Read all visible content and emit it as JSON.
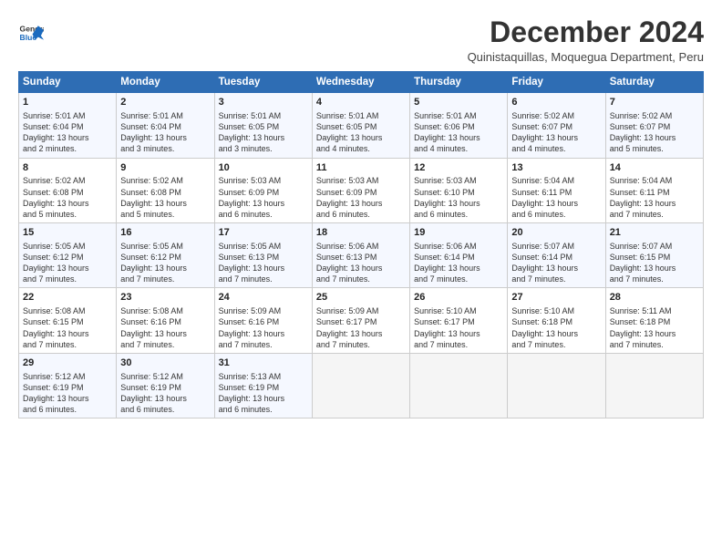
{
  "header": {
    "logo_general": "General",
    "logo_blue": "Blue",
    "title": "December 2024",
    "subtitle": "Quinistaquillas, Moquegua Department, Peru"
  },
  "calendar": {
    "columns": [
      "Sunday",
      "Monday",
      "Tuesday",
      "Wednesday",
      "Thursday",
      "Friday",
      "Saturday"
    ],
    "rows": [
      [
        {
          "day": "1",
          "lines": [
            "Sunrise: 5:01 AM",
            "Sunset: 6:04 PM",
            "Daylight: 13 hours",
            "and 2 minutes."
          ]
        },
        {
          "day": "2",
          "lines": [
            "Sunrise: 5:01 AM",
            "Sunset: 6:04 PM",
            "Daylight: 13 hours",
            "and 3 minutes."
          ]
        },
        {
          "day": "3",
          "lines": [
            "Sunrise: 5:01 AM",
            "Sunset: 6:05 PM",
            "Daylight: 13 hours",
            "and 3 minutes."
          ]
        },
        {
          "day": "4",
          "lines": [
            "Sunrise: 5:01 AM",
            "Sunset: 6:05 PM",
            "Daylight: 13 hours",
            "and 4 minutes."
          ]
        },
        {
          "day": "5",
          "lines": [
            "Sunrise: 5:01 AM",
            "Sunset: 6:06 PM",
            "Daylight: 13 hours",
            "and 4 minutes."
          ]
        },
        {
          "day": "6",
          "lines": [
            "Sunrise: 5:02 AM",
            "Sunset: 6:07 PM",
            "Daylight: 13 hours",
            "and 4 minutes."
          ]
        },
        {
          "day": "7",
          "lines": [
            "Sunrise: 5:02 AM",
            "Sunset: 6:07 PM",
            "Daylight: 13 hours",
            "and 5 minutes."
          ]
        }
      ],
      [
        {
          "day": "8",
          "lines": [
            "Sunrise: 5:02 AM",
            "Sunset: 6:08 PM",
            "Daylight: 13 hours",
            "and 5 minutes."
          ]
        },
        {
          "day": "9",
          "lines": [
            "Sunrise: 5:02 AM",
            "Sunset: 6:08 PM",
            "Daylight: 13 hours",
            "and 5 minutes."
          ]
        },
        {
          "day": "10",
          "lines": [
            "Sunrise: 5:03 AM",
            "Sunset: 6:09 PM",
            "Daylight: 13 hours",
            "and 6 minutes."
          ]
        },
        {
          "day": "11",
          "lines": [
            "Sunrise: 5:03 AM",
            "Sunset: 6:09 PM",
            "Daylight: 13 hours",
            "and 6 minutes."
          ]
        },
        {
          "day": "12",
          "lines": [
            "Sunrise: 5:03 AM",
            "Sunset: 6:10 PM",
            "Daylight: 13 hours",
            "and 6 minutes."
          ]
        },
        {
          "day": "13",
          "lines": [
            "Sunrise: 5:04 AM",
            "Sunset: 6:11 PM",
            "Daylight: 13 hours",
            "and 6 minutes."
          ]
        },
        {
          "day": "14",
          "lines": [
            "Sunrise: 5:04 AM",
            "Sunset: 6:11 PM",
            "Daylight: 13 hours",
            "and 7 minutes."
          ]
        }
      ],
      [
        {
          "day": "15",
          "lines": [
            "Sunrise: 5:05 AM",
            "Sunset: 6:12 PM",
            "Daylight: 13 hours",
            "and 7 minutes."
          ]
        },
        {
          "day": "16",
          "lines": [
            "Sunrise: 5:05 AM",
            "Sunset: 6:12 PM",
            "Daylight: 13 hours",
            "and 7 minutes."
          ]
        },
        {
          "day": "17",
          "lines": [
            "Sunrise: 5:05 AM",
            "Sunset: 6:13 PM",
            "Daylight: 13 hours",
            "and 7 minutes."
          ]
        },
        {
          "day": "18",
          "lines": [
            "Sunrise: 5:06 AM",
            "Sunset: 6:13 PM",
            "Daylight: 13 hours",
            "and 7 minutes."
          ]
        },
        {
          "day": "19",
          "lines": [
            "Sunrise: 5:06 AM",
            "Sunset: 6:14 PM",
            "Daylight: 13 hours",
            "and 7 minutes."
          ]
        },
        {
          "day": "20",
          "lines": [
            "Sunrise: 5:07 AM",
            "Sunset: 6:14 PM",
            "Daylight: 13 hours",
            "and 7 minutes."
          ]
        },
        {
          "day": "21",
          "lines": [
            "Sunrise: 5:07 AM",
            "Sunset: 6:15 PM",
            "Daylight: 13 hours",
            "and 7 minutes."
          ]
        }
      ],
      [
        {
          "day": "22",
          "lines": [
            "Sunrise: 5:08 AM",
            "Sunset: 6:15 PM",
            "Daylight: 13 hours",
            "and 7 minutes."
          ]
        },
        {
          "day": "23",
          "lines": [
            "Sunrise: 5:08 AM",
            "Sunset: 6:16 PM",
            "Daylight: 13 hours",
            "and 7 minutes."
          ]
        },
        {
          "day": "24",
          "lines": [
            "Sunrise: 5:09 AM",
            "Sunset: 6:16 PM",
            "Daylight: 13 hours",
            "and 7 minutes."
          ]
        },
        {
          "day": "25",
          "lines": [
            "Sunrise: 5:09 AM",
            "Sunset: 6:17 PM",
            "Daylight: 13 hours",
            "and 7 minutes."
          ]
        },
        {
          "day": "26",
          "lines": [
            "Sunrise: 5:10 AM",
            "Sunset: 6:17 PM",
            "Daylight: 13 hours",
            "and 7 minutes."
          ]
        },
        {
          "day": "27",
          "lines": [
            "Sunrise: 5:10 AM",
            "Sunset: 6:18 PM",
            "Daylight: 13 hours",
            "and 7 minutes."
          ]
        },
        {
          "day": "28",
          "lines": [
            "Sunrise: 5:11 AM",
            "Sunset: 6:18 PM",
            "Daylight: 13 hours",
            "and 7 minutes."
          ]
        }
      ],
      [
        {
          "day": "29",
          "lines": [
            "Sunrise: 5:12 AM",
            "Sunset: 6:19 PM",
            "Daylight: 13 hours",
            "and 6 minutes."
          ]
        },
        {
          "day": "30",
          "lines": [
            "Sunrise: 5:12 AM",
            "Sunset: 6:19 PM",
            "Daylight: 13 hours",
            "and 6 minutes."
          ]
        },
        {
          "day": "31",
          "lines": [
            "Sunrise: 5:13 AM",
            "Sunset: 6:19 PM",
            "Daylight: 13 hours",
            "and 6 minutes."
          ]
        },
        {
          "day": "",
          "lines": []
        },
        {
          "day": "",
          "lines": []
        },
        {
          "day": "",
          "lines": []
        },
        {
          "day": "",
          "lines": []
        }
      ]
    ]
  }
}
